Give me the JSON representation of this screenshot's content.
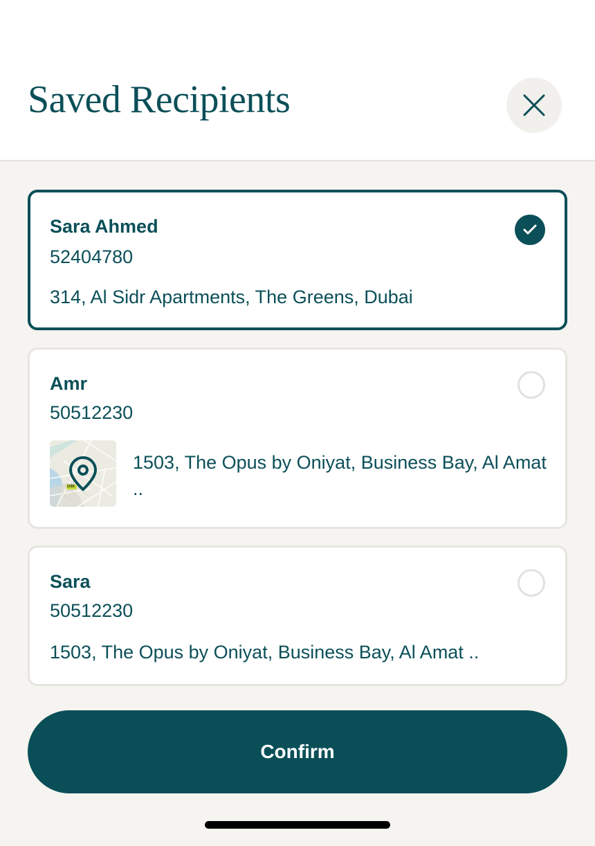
{
  "header": {
    "title": "Saved Recipients",
    "close_icon": "close-icon"
  },
  "recipients": [
    {
      "name": "Sara Ahmed",
      "phone": "52404780",
      "address": "314, Al Sidr Apartments, The Greens, Dubai",
      "selected": true
    },
    {
      "name": "Amr",
      "phone": "50512230",
      "address": "1503, The Opus by Oniyat, Business Bay, Al Amat ..",
      "map_label": "D86",
      "selected": false
    },
    {
      "name": "Sara",
      "phone": "50512230",
      "address": "1503, The Opus by Oniyat, Business Bay, Al Amat ..",
      "selected": false
    }
  ],
  "actions": {
    "confirm_label": "Confirm"
  },
  "colors": {
    "primary": "#0b4f58",
    "background": "#f5f4f0",
    "card_border": "#e6e5e1"
  }
}
